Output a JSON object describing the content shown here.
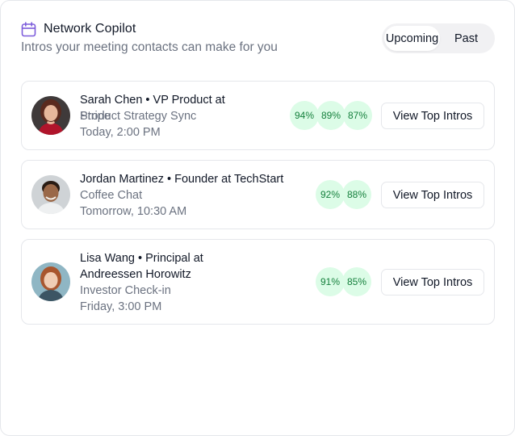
{
  "header": {
    "title": "Network Copilot",
    "subtitle": "Intros your meeting contacts can make for you",
    "toggle": {
      "options": [
        "Upcoming",
        "Past"
      ],
      "active": "Upcoming"
    }
  },
  "meetings": [
    {
      "name_line1": "Sarah Chen • VP Product at",
      "name_line2": "Stripe",
      "meeting": "Product Strategy Sync",
      "time": "Today, 2:00 PM",
      "scores": [
        "94%",
        "89%",
        "87%"
      ],
      "button": "View Top Intros"
    },
    {
      "name_line1": "Jordan Martinez • Founder at TechStart",
      "meeting": "Coffee Chat",
      "time": "Tomorrow, 10:30 AM",
      "scores": [
        "92%",
        "88%"
      ],
      "button": "View Top Intros"
    },
    {
      "name_line1": "Lisa Wang • Principal at",
      "name_line2": "Andreessen Horowitz",
      "meeting": "Investor Check-in",
      "time": "Friday, 3:00 PM",
      "scores": [
        "91%",
        "85%"
      ],
      "button": "View Top Intros"
    }
  ],
  "colors": {
    "accent": "#7c5cdb",
    "score_bg": "#dcfce7",
    "score_text": "#15803d"
  }
}
